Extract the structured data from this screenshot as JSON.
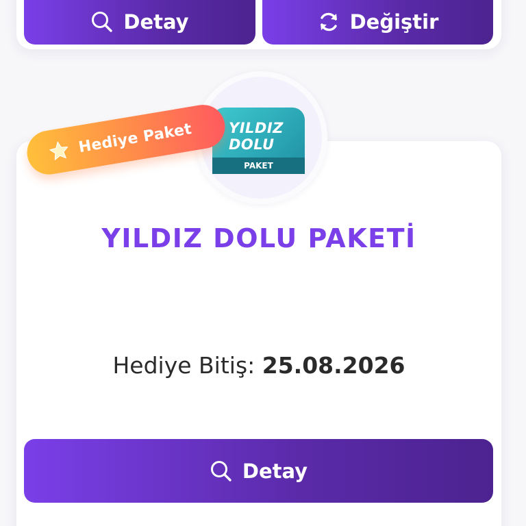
{
  "top_card": {
    "detay_label": "Detay",
    "degistir_label": "Değiştir"
  },
  "package": {
    "ribbon_text": "Hediye Paket",
    "logo_line1": "YILDIZ",
    "logo_line2": "DOLU",
    "logo_strip": "PAKET",
    "title": "YILDIZ DOLU PAKETİ",
    "expiry_label": "Hediye Bitiş:",
    "expiry_date": "25.08.2026",
    "detay_label": "Detay"
  },
  "icons": {
    "search": "search-icon",
    "refresh": "refresh-icon",
    "star": "star-icon"
  },
  "colors": {
    "accent": "#7a3fe8",
    "button_gradient_start": "#7a3fe8",
    "button_gradient_end": "#4c2390",
    "ribbon_start": "#ffc03a",
    "ribbon_end": "#ff5a5f",
    "logo_teal": "#2fb3bf"
  }
}
